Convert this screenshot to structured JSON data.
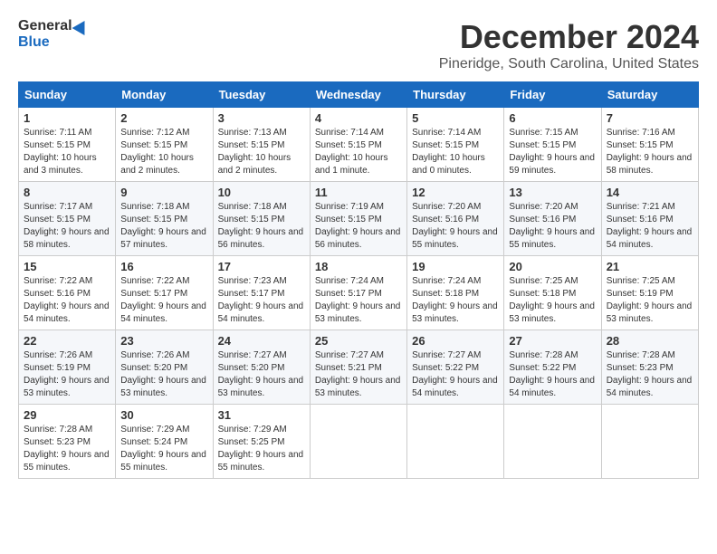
{
  "header": {
    "logo_general": "General",
    "logo_blue": "Blue",
    "month_title": "December 2024",
    "location": "Pineridge, South Carolina, United States"
  },
  "weekdays": [
    "Sunday",
    "Monday",
    "Tuesday",
    "Wednesday",
    "Thursday",
    "Friday",
    "Saturday"
  ],
  "weeks": [
    [
      {
        "day": "1",
        "sunrise": "Sunrise: 7:11 AM",
        "sunset": "Sunset: 5:15 PM",
        "daylight": "Daylight: 10 hours and 3 minutes."
      },
      {
        "day": "2",
        "sunrise": "Sunrise: 7:12 AM",
        "sunset": "Sunset: 5:15 PM",
        "daylight": "Daylight: 10 hours and 2 minutes."
      },
      {
        "day": "3",
        "sunrise": "Sunrise: 7:13 AM",
        "sunset": "Sunset: 5:15 PM",
        "daylight": "Daylight: 10 hours and 2 minutes."
      },
      {
        "day": "4",
        "sunrise": "Sunrise: 7:14 AM",
        "sunset": "Sunset: 5:15 PM",
        "daylight": "Daylight: 10 hours and 1 minute."
      },
      {
        "day": "5",
        "sunrise": "Sunrise: 7:14 AM",
        "sunset": "Sunset: 5:15 PM",
        "daylight": "Daylight: 10 hours and 0 minutes."
      },
      {
        "day": "6",
        "sunrise": "Sunrise: 7:15 AM",
        "sunset": "Sunset: 5:15 PM",
        "daylight": "Daylight: 9 hours and 59 minutes."
      },
      {
        "day": "7",
        "sunrise": "Sunrise: 7:16 AM",
        "sunset": "Sunset: 5:15 PM",
        "daylight": "Daylight: 9 hours and 58 minutes."
      }
    ],
    [
      {
        "day": "8",
        "sunrise": "Sunrise: 7:17 AM",
        "sunset": "Sunset: 5:15 PM",
        "daylight": "Daylight: 9 hours and 58 minutes."
      },
      {
        "day": "9",
        "sunrise": "Sunrise: 7:18 AM",
        "sunset": "Sunset: 5:15 PM",
        "daylight": "Daylight: 9 hours and 57 minutes."
      },
      {
        "day": "10",
        "sunrise": "Sunrise: 7:18 AM",
        "sunset": "Sunset: 5:15 PM",
        "daylight": "Daylight: 9 hours and 56 minutes."
      },
      {
        "day": "11",
        "sunrise": "Sunrise: 7:19 AM",
        "sunset": "Sunset: 5:15 PM",
        "daylight": "Daylight: 9 hours and 56 minutes."
      },
      {
        "day": "12",
        "sunrise": "Sunrise: 7:20 AM",
        "sunset": "Sunset: 5:16 PM",
        "daylight": "Daylight: 9 hours and 55 minutes."
      },
      {
        "day": "13",
        "sunrise": "Sunrise: 7:20 AM",
        "sunset": "Sunset: 5:16 PM",
        "daylight": "Daylight: 9 hours and 55 minutes."
      },
      {
        "day": "14",
        "sunrise": "Sunrise: 7:21 AM",
        "sunset": "Sunset: 5:16 PM",
        "daylight": "Daylight: 9 hours and 54 minutes."
      }
    ],
    [
      {
        "day": "15",
        "sunrise": "Sunrise: 7:22 AM",
        "sunset": "Sunset: 5:16 PM",
        "daylight": "Daylight: 9 hours and 54 minutes."
      },
      {
        "day": "16",
        "sunrise": "Sunrise: 7:22 AM",
        "sunset": "Sunset: 5:17 PM",
        "daylight": "Daylight: 9 hours and 54 minutes."
      },
      {
        "day": "17",
        "sunrise": "Sunrise: 7:23 AM",
        "sunset": "Sunset: 5:17 PM",
        "daylight": "Daylight: 9 hours and 54 minutes."
      },
      {
        "day": "18",
        "sunrise": "Sunrise: 7:24 AM",
        "sunset": "Sunset: 5:17 PM",
        "daylight": "Daylight: 9 hours and 53 minutes."
      },
      {
        "day": "19",
        "sunrise": "Sunrise: 7:24 AM",
        "sunset": "Sunset: 5:18 PM",
        "daylight": "Daylight: 9 hours and 53 minutes."
      },
      {
        "day": "20",
        "sunrise": "Sunrise: 7:25 AM",
        "sunset": "Sunset: 5:18 PM",
        "daylight": "Daylight: 9 hours and 53 minutes."
      },
      {
        "day": "21",
        "sunrise": "Sunrise: 7:25 AM",
        "sunset": "Sunset: 5:19 PM",
        "daylight": "Daylight: 9 hours and 53 minutes."
      }
    ],
    [
      {
        "day": "22",
        "sunrise": "Sunrise: 7:26 AM",
        "sunset": "Sunset: 5:19 PM",
        "daylight": "Daylight: 9 hours and 53 minutes."
      },
      {
        "day": "23",
        "sunrise": "Sunrise: 7:26 AM",
        "sunset": "Sunset: 5:20 PM",
        "daylight": "Daylight: 9 hours and 53 minutes."
      },
      {
        "day": "24",
        "sunrise": "Sunrise: 7:27 AM",
        "sunset": "Sunset: 5:20 PM",
        "daylight": "Daylight: 9 hours and 53 minutes."
      },
      {
        "day": "25",
        "sunrise": "Sunrise: 7:27 AM",
        "sunset": "Sunset: 5:21 PM",
        "daylight": "Daylight: 9 hours and 53 minutes."
      },
      {
        "day": "26",
        "sunrise": "Sunrise: 7:27 AM",
        "sunset": "Sunset: 5:22 PM",
        "daylight": "Daylight: 9 hours and 54 minutes."
      },
      {
        "day": "27",
        "sunrise": "Sunrise: 7:28 AM",
        "sunset": "Sunset: 5:22 PM",
        "daylight": "Daylight: 9 hours and 54 minutes."
      },
      {
        "day": "28",
        "sunrise": "Sunrise: 7:28 AM",
        "sunset": "Sunset: 5:23 PM",
        "daylight": "Daylight: 9 hours and 54 minutes."
      }
    ],
    [
      {
        "day": "29",
        "sunrise": "Sunrise: 7:28 AM",
        "sunset": "Sunset: 5:23 PM",
        "daylight": "Daylight: 9 hours and 55 minutes."
      },
      {
        "day": "30",
        "sunrise": "Sunrise: 7:29 AM",
        "sunset": "Sunset: 5:24 PM",
        "daylight": "Daylight: 9 hours and 55 minutes."
      },
      {
        "day": "31",
        "sunrise": "Sunrise: 7:29 AM",
        "sunset": "Sunset: 5:25 PM",
        "daylight": "Daylight: 9 hours and 55 minutes."
      },
      null,
      null,
      null,
      null
    ]
  ]
}
